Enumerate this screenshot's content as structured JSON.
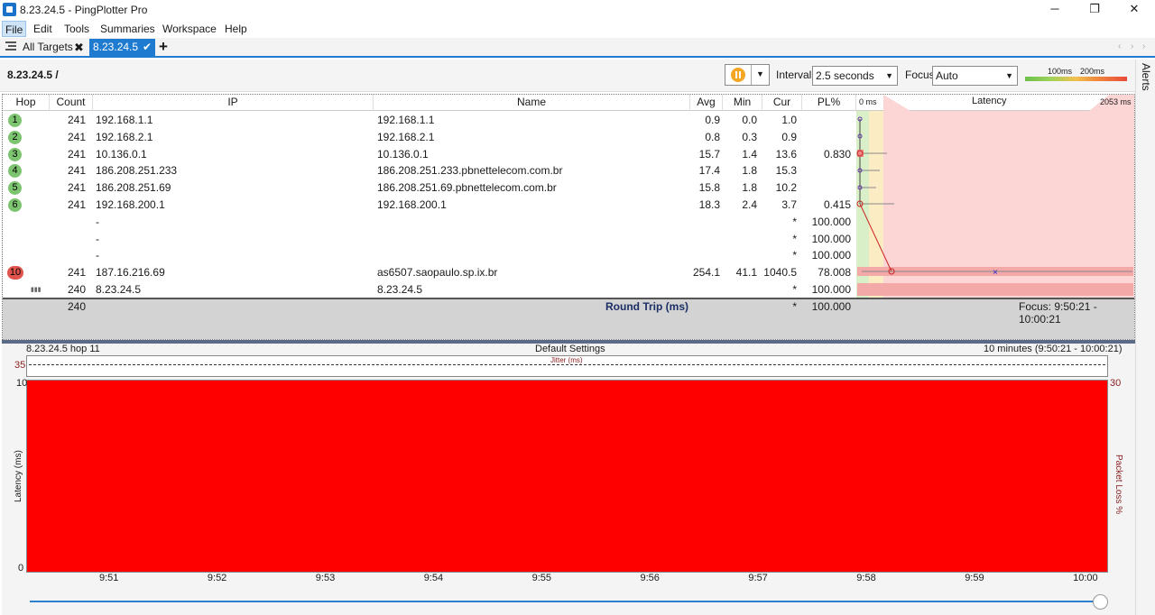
{
  "window": {
    "title": "8.23.24.5 - PingPlotter Pro",
    "minimize": "─",
    "maximize": "❐",
    "close": "✕"
  },
  "menu": [
    "File",
    "Edit",
    "Tools",
    "Summaries",
    "Workspace",
    "Help"
  ],
  "tabs": {
    "all_targets": "All Targets",
    "active": "8.23.24.5",
    "add": "+"
  },
  "header": {
    "target": "8.23.24.5 /",
    "interval_label": "Interval",
    "interval_value": "2.5 seconds",
    "focus_label": "Focus",
    "focus_value": "Auto",
    "legend_100": "100ms",
    "legend_200": "200ms"
  },
  "alerts": "Alerts",
  "columns": {
    "hop": "Hop",
    "count": "Count",
    "ip": "IP",
    "name": "Name",
    "avg": "Avg",
    "min": "Min",
    "cur": "Cur",
    "pl": "PL%",
    "latency_min": "0 ms",
    "latency": "Latency",
    "latency_max": "2053 ms"
  },
  "rows": [
    {
      "hop": "1",
      "count": "241",
      "ip": "192.168.1.1",
      "name": "192.168.1.1",
      "avg": "0.9",
      "min": "0.0",
      "cur": "1.0",
      "pl": ""
    },
    {
      "hop": "2",
      "count": "241",
      "ip": "192.168.2.1",
      "name": "192.168.2.1",
      "avg": "0.8",
      "min": "0.3",
      "cur": "0.9",
      "pl": ""
    },
    {
      "hop": "3",
      "count": "241",
      "ip": "10.136.0.1",
      "name": "10.136.0.1",
      "avg": "15.7",
      "min": "1.4",
      "cur": "13.6",
      "pl": "0.830"
    },
    {
      "hop": "4",
      "count": "241",
      "ip": "186.208.251.233",
      "name": "186.208.251.233.pbnettelecom.com.br",
      "avg": "17.4",
      "min": "1.8",
      "cur": "15.3",
      "pl": ""
    },
    {
      "hop": "5",
      "count": "241",
      "ip": "186.208.251.69",
      "name": "186.208.251.69.pbnettelecom.com.br",
      "avg": "15.8",
      "min": "1.8",
      "cur": "10.2",
      "pl": ""
    },
    {
      "hop": "6",
      "count": "241",
      "ip": "192.168.200.1",
      "name": "192.168.200.1",
      "avg": "18.3",
      "min": "2.4",
      "cur": "3.7",
      "pl": "0.415"
    },
    {
      "hop": "",
      "count": "",
      "ip": "-",
      "name": "",
      "avg": "",
      "min": "",
      "cur": "*",
      "pl": "100.000"
    },
    {
      "hop": "",
      "count": "",
      "ip": "-",
      "name": "",
      "avg": "",
      "min": "",
      "cur": "*",
      "pl": "100.000"
    },
    {
      "hop": "",
      "count": "",
      "ip": "-",
      "name": "",
      "avg": "",
      "min": "",
      "cur": "*",
      "pl": "100.000"
    },
    {
      "hop": "10",
      "count": "241",
      "ip": "187.16.216.69",
      "name": "as6507.saopaulo.sp.ix.br",
      "avg": "254.1",
      "min": "41.1",
      "cur": "1040.5",
      "pl": "78.008"
    },
    {
      "hop": "",
      "count": "240",
      "ip": "8.23.24.5",
      "name": "8.23.24.5",
      "avg": "",
      "min": "",
      "cur": "*",
      "pl": "100.000"
    }
  ],
  "summary": {
    "count": "240",
    "label": "Round Trip (ms)",
    "cur": "*",
    "pl": "100.000",
    "focus": "Focus: 9:50:21 - 10:00:21"
  },
  "timeline": {
    "hop_label": "8.23.24.5 hop 11",
    "settings": "Default Settings",
    "range": "10 minutes (9:50:21 - 10:00:21)",
    "jitter_label": "Jitter (ms)",
    "jitter_max": "35",
    "y_max": "10",
    "y_min": "0",
    "y_label": "Latency (ms)",
    "pl_max": "30",
    "pl_label": "Packet Loss %",
    "x_ticks": [
      "9:51",
      "9:52",
      "9:53",
      "9:54",
      "9:55",
      "9:56",
      "9:57",
      "9:58",
      "9:59",
      "10:00"
    ],
    "loss_color": "#ff0000"
  }
}
